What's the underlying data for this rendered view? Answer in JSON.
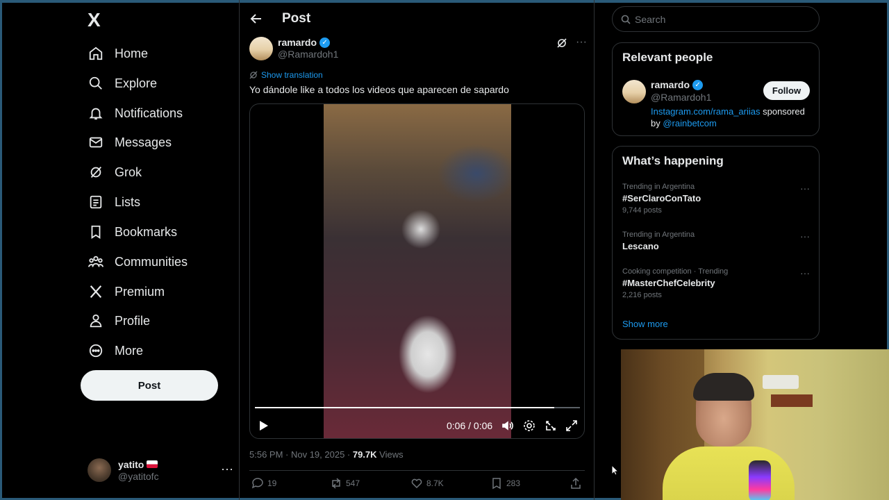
{
  "sidebar": {
    "logo": "X",
    "nav": [
      {
        "label": "Home",
        "icon": "home-icon"
      },
      {
        "label": "Explore",
        "icon": "search-icon"
      },
      {
        "label": "Notifications",
        "icon": "bell-icon"
      },
      {
        "label": "Messages",
        "icon": "envelope-icon"
      },
      {
        "label": "Grok",
        "icon": "grok-icon"
      },
      {
        "label": "Lists",
        "icon": "list-icon"
      },
      {
        "label": "Bookmarks",
        "icon": "bookmark-icon"
      },
      {
        "label": "Communities",
        "icon": "people-icon"
      },
      {
        "label": "Premium",
        "icon": "x-icon"
      },
      {
        "label": "Profile",
        "icon": "person-icon"
      },
      {
        "label": "More",
        "icon": "more-circle-icon"
      }
    ],
    "post_button": "Post",
    "account": {
      "name": "yatito",
      "handle": "@yatitofc",
      "more": "···"
    }
  },
  "main": {
    "header_title": "Post",
    "author": {
      "name": "ramardo",
      "handle": "@Ramardoh1",
      "more": "···"
    },
    "translate_label": "Show translation",
    "text": "Yo dándole like a todos los videos que aparecen de sapardo",
    "video": {
      "time": "0:06 / 0:06",
      "progress": 0.92
    },
    "timestamp": "5:56 PM · Nov 19, 2025 · ",
    "views_count": "79.7K",
    "views_label": " Views",
    "actions": {
      "replies": "19",
      "reposts": "547",
      "likes": "8.7K",
      "bookmarks": "283"
    }
  },
  "right": {
    "search_placeholder": "Search",
    "relevant": {
      "title": "Relevant people",
      "name": "ramardo",
      "handle": "@Ramardoh1",
      "follow": "Follow",
      "bio_link": "Instagram.com/rama_ariias",
      "bio_mid": " sponsored by ",
      "bio_mention": "@rainbetcom"
    },
    "happening": {
      "title": "What’s happening",
      "trends": [
        {
          "context": "Trending in Argentina",
          "name": "#SerClaroConTato",
          "count": "9,744 posts"
        },
        {
          "context": "Trending in Argentina",
          "name": "Lescano",
          "count": ""
        },
        {
          "context": "Cooking competition · Trending",
          "name": "#MasterChefCelebrity",
          "count": "2,216 posts"
        }
      ],
      "show_more": "Show more",
      "trend_more": "···"
    }
  }
}
